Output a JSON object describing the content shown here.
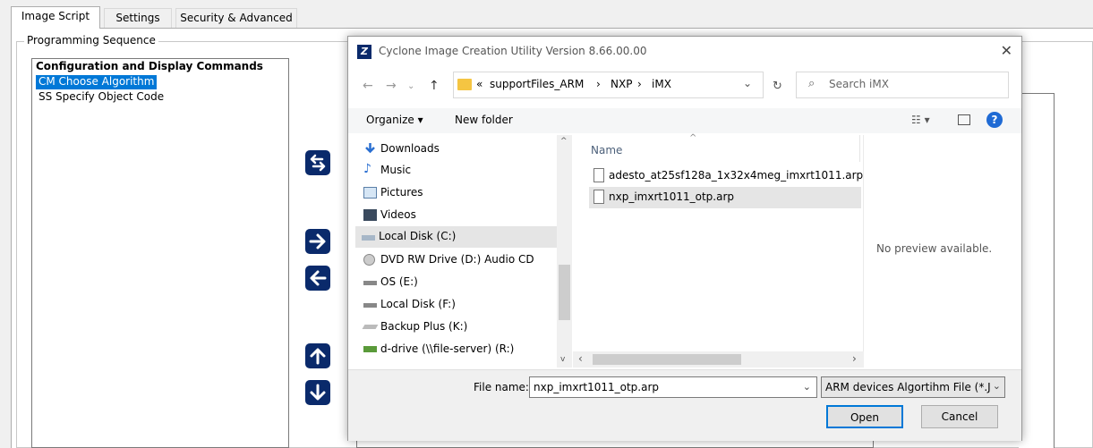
{
  "tabs": [
    "Image Script",
    "Settings",
    "Security & Advanced"
  ],
  "group_title": "Programming Sequence",
  "sequence": {
    "header": "Configuration and Display Commands",
    "items": [
      "CM  Choose Algorithm",
      "SS  Specify Object Code"
    ]
  },
  "dialog": {
    "title": "Cyclone Image Creation Utility  Version 8.66.00.00",
    "app_icon_letter": "Z",
    "breadcrumb": [
      "«",
      "supportFiles_ARM",
      "›",
      "NXP",
      "›",
      "iMX"
    ],
    "search_placeholder": "Search iMX",
    "toolbar": {
      "organize": "Organize ▾",
      "new_folder": "New folder"
    },
    "nav_items": [
      "Downloads",
      "Music",
      "Pictures",
      "Videos",
      "Local Disk (C:)",
      "DVD RW Drive (D:) Audio CD",
      "OS (E:)",
      "Local Disk (F:)",
      "Backup Plus (K:)",
      "d-drive (\\\\file-server) (R:)"
    ],
    "selected_nav": "Local Disk (C:)",
    "column_name": "Name",
    "files": [
      "adesto_at25sf128a_1x32x4meg_imxrt1011.arp",
      "nxp_imxrt1011_otp.arp"
    ],
    "selected_file": "nxp_imxrt1011_otp.arp",
    "preview_text": "No preview available.",
    "file_name_label": "File name:",
    "file_name_value": "nxp_imxrt1011_otp.arp",
    "file_type": "ARM devices Algortihm File (*.J",
    "open_label": "Open",
    "cancel_label": "Cancel"
  },
  "colors": {
    "accent": "#0078d7",
    "arrow_button": "#0a2a6b",
    "selection": "#e5e5e5"
  }
}
